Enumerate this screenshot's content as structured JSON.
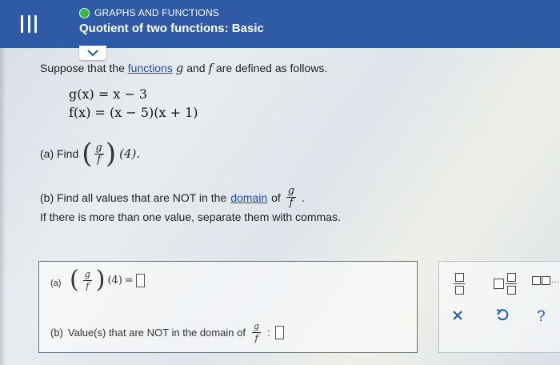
{
  "header": {
    "topic": "GRAPHS AND FUNCTIONS",
    "title": "Quotient of two functions: Basic"
  },
  "question": {
    "intro_prefix": "Suppose that the",
    "intro_link": "functions",
    "intro_suffix": "are defined as follows.",
    "g_var": "g",
    "and_word": "and",
    "f_var": "f",
    "eq_g": "g(x) = x − 3",
    "eq_f": "f(x) = (x − 5)(x + 1)",
    "part_a_label": "(a) Find",
    "frac_num": "g",
    "frac_den": "f",
    "part_a_arg": "(4).",
    "part_b_prefix": "(b) Find all values that are NOT in the",
    "part_b_link": "domain",
    "part_b_of": "of",
    "part_b_end": ".",
    "note": "If there is more than one value, separate them with commas."
  },
  "answer": {
    "a_label": "(a)",
    "a_arg": "(4)",
    "a_eq": "=",
    "b_label": "(b)",
    "b_text": "Value(s) that are NOT in the domain of",
    "b_colon": ":"
  },
  "tools": {
    "more": "…",
    "clear_icon": "x-icon",
    "undo_icon": "undo-icon",
    "help": "?"
  },
  "colors": {
    "header": "#2f5aa5",
    "link": "#1a4fb3",
    "accent": "#1d5aa8",
    "topic_dot": "#3bb54a"
  }
}
